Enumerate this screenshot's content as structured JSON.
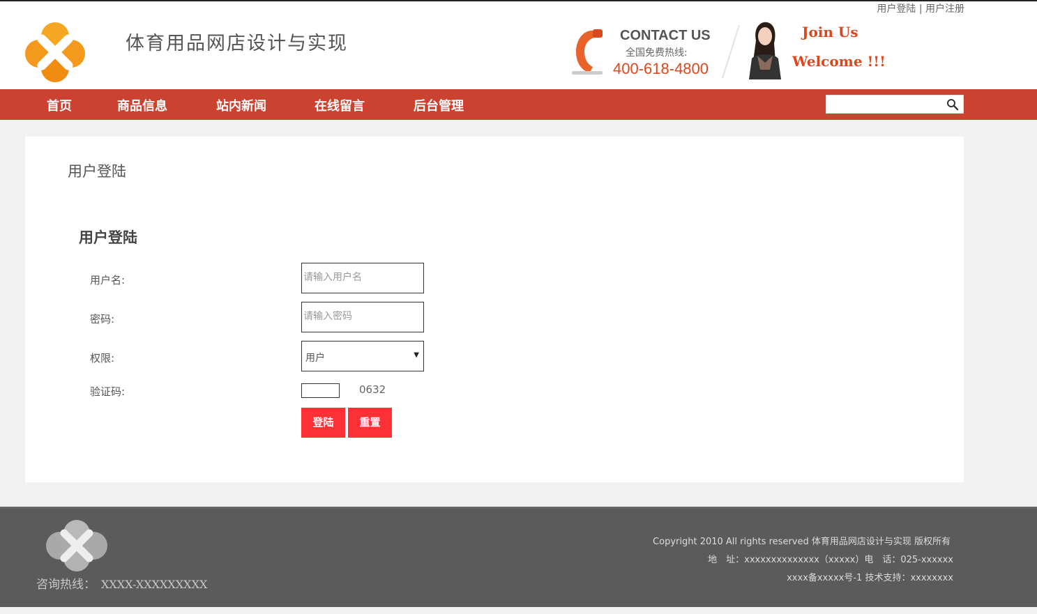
{
  "top_links": {
    "login": "用户登陆",
    "separator": "|",
    "register": "用户注册"
  },
  "header": {
    "site_title": "体育用品网店设计与实现",
    "contact_title": "CONTACT US",
    "contact_sub": "全国免费热线:",
    "contact_phone": "400-618-4800",
    "join": "Join Us",
    "welcome": "Welcome !!!"
  },
  "nav": {
    "items": [
      "首页",
      "商品信息",
      "站内新闻",
      "在线留言",
      "后台管理"
    ],
    "search_placeholder": ""
  },
  "main": {
    "panel_title": "用户登陆",
    "form_title": "用户登陆",
    "username_label": "用户名:",
    "username_placeholder": "请输入用户名",
    "password_label": "密码:",
    "password_placeholder": "请输入密码",
    "role_label": "权限:",
    "role_selected": "用户",
    "captcha_label": "验证码:",
    "captcha_code": "0632",
    "login_button": "登陆",
    "reset_button": "重置"
  },
  "footer": {
    "hotline_label": "咨询热线：",
    "hotline_number": "XXXX-XXXXXXXXX",
    "copyright": "Copyright 2010 All rights reserved 体育用品网店设计与实现 版权所有",
    "address": "地　址：xxxxxxxxxxxxxx（xxxxx）电　话：025-xxxxxx",
    "icp": "xxxx备xxxxx号-1 技术支持：xxxxxxxx"
  },
  "colors": {
    "nav_bg": "#cb4230",
    "accent": "#d9481e",
    "button": "#fb3136",
    "footer_bg": "#5b5b5b"
  }
}
